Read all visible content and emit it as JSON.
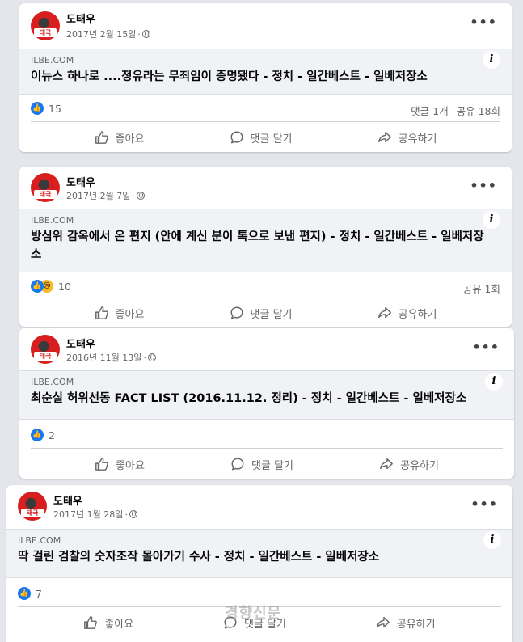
{
  "posts": [
    {
      "author": "도태우",
      "avatar_text": "태극",
      "date": "2017년 2월 15일",
      "domain": "ILBE.COM",
      "title": "이뉴스 하나로 ....정유라는 무죄임이 증명됐다 - 정치 - 일간베스트 - 일베저장소",
      "reactions": [
        "like"
      ],
      "reaction_count": "15",
      "comments": "댓글 1개",
      "shares": "공유 18회"
    },
    {
      "author": "도태우",
      "avatar_text": "태극",
      "date": "2017년 2월 7일",
      "domain": "ILBE.COM",
      "title": "방심위 감옥에서 온 편지 (안에 계신 분이 톡으로 보낸 편지) - 정치 - 일간베스트 - 일베저장소",
      "reactions": [
        "like",
        "sad"
      ],
      "reaction_count": "10",
      "comments": "",
      "shares": "공유 1회"
    },
    {
      "author": "도태우",
      "avatar_text": "태극",
      "date": "2016년 11월 13일",
      "domain": "ILBE.COM",
      "title": "최순실 허위선동 FACT LIST (2016.11.12. 정리) - 정치 - 일간베스트 - 일베저장소",
      "reactions": [
        "like"
      ],
      "reaction_count": "2",
      "comments": "",
      "shares": ""
    },
    {
      "author": "도태우",
      "avatar_text": "태극",
      "date": "2017년 1월 28일",
      "domain": "ILBE.COM",
      "title": "딱 걸린 검찰의 숫자조작 몰아가기 수사 - 정치 - 일간베스트 - 일베저장소",
      "reactions": [
        "like"
      ],
      "reaction_count": "7",
      "comments": "",
      "shares": ""
    }
  ],
  "actions": {
    "like": "좋아요",
    "comment": "댓글 달기",
    "share": "공유하기"
  },
  "more_glyph": "•••",
  "info_glyph": "i",
  "watermark": "경향신문",
  "colors": {
    "accent": "#1877f2",
    "sad": "#f7b928",
    "link_bg": "#f0f2f5",
    "muted_text": "#65676b"
  },
  "icons": [
    "like-icon",
    "comment-icon",
    "share-icon",
    "globe-icon",
    "info-icon",
    "more-icon"
  ]
}
